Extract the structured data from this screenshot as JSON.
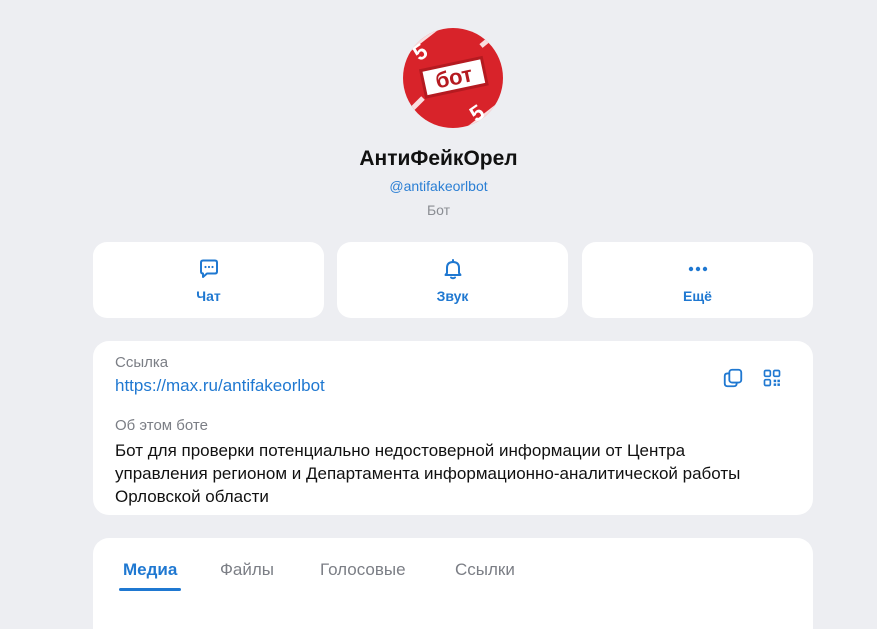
{
  "profile": {
    "avatar_text": "бот",
    "name": "АнтиФейкОрел",
    "handle": "@antifakeorlbot",
    "kind": "Бот"
  },
  "actions": [
    {
      "label": "Чат",
      "icon": "chat-bubble-icon"
    },
    {
      "label": "Звук",
      "icon": "bell-icon"
    },
    {
      "label": "Ещё",
      "icon": "more-dots-icon"
    }
  ],
  "info": {
    "link_caption": "Ссылка",
    "link_value": "https://max.ru/antifakeorlbot",
    "about_caption": "Об этом боте",
    "about_text": "Бот для проверки потенциально недостоверной информации от Центра управления регионом и Департамента информационно-аналитической работы Орловской области",
    "copy_icon": "copy-icon",
    "qr_icon": "qr-code-icon"
  },
  "tabs": [
    {
      "label": "Медиа",
      "active": true
    },
    {
      "label": "Файлы",
      "active": false
    },
    {
      "label": "Голосовые",
      "active": false
    },
    {
      "label": "Ссылки",
      "active": false
    }
  ],
  "colors": {
    "accent": "#1f78d1",
    "avatar_red": "#d8232a",
    "background": "#edeef2"
  }
}
